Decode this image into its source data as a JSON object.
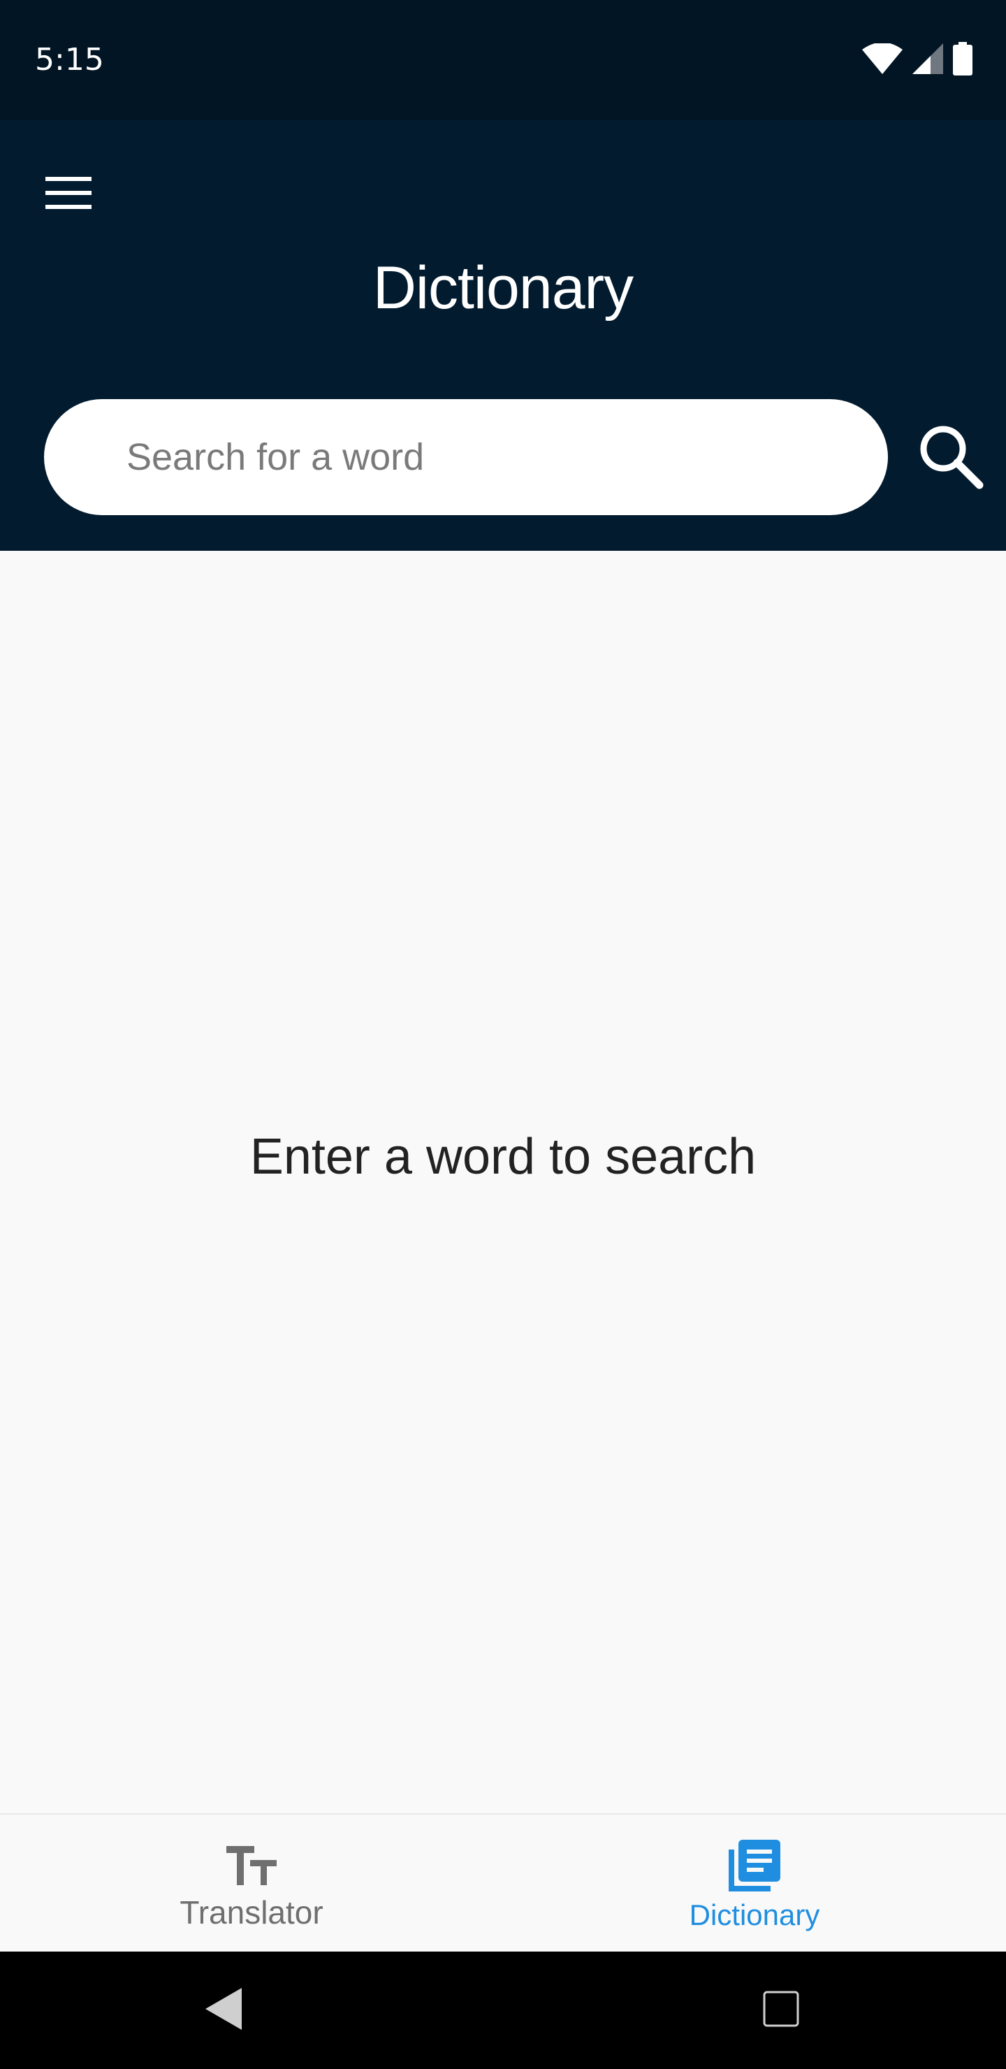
{
  "status_bar": {
    "time": "5:15",
    "icons": [
      "wifi-icon",
      "cell-signal-icon",
      "battery-icon"
    ]
  },
  "app_bar": {
    "menu_icon": "hamburger-menu-icon",
    "title": "Dictionary",
    "search": {
      "placeholder": "Search for a word",
      "value": "",
      "button_icon": "search-icon"
    }
  },
  "main": {
    "empty_message": "Enter a word to search"
  },
  "bottom_nav": {
    "items": [
      {
        "label": "Translator",
        "icon": "text-size-icon",
        "active": false
      },
      {
        "label": "Dictionary",
        "icon": "dictionary-icon",
        "active": true
      }
    ]
  },
  "system_nav": {
    "buttons": [
      "back-icon",
      "recents-icon"
    ]
  },
  "colors": {
    "status_bar_bg": "#021524",
    "app_bar_bg": "#021b2e",
    "content_bg": "#f9f9f9",
    "accent": "#1f8ee0",
    "inactive": "#6f6f6f"
  }
}
